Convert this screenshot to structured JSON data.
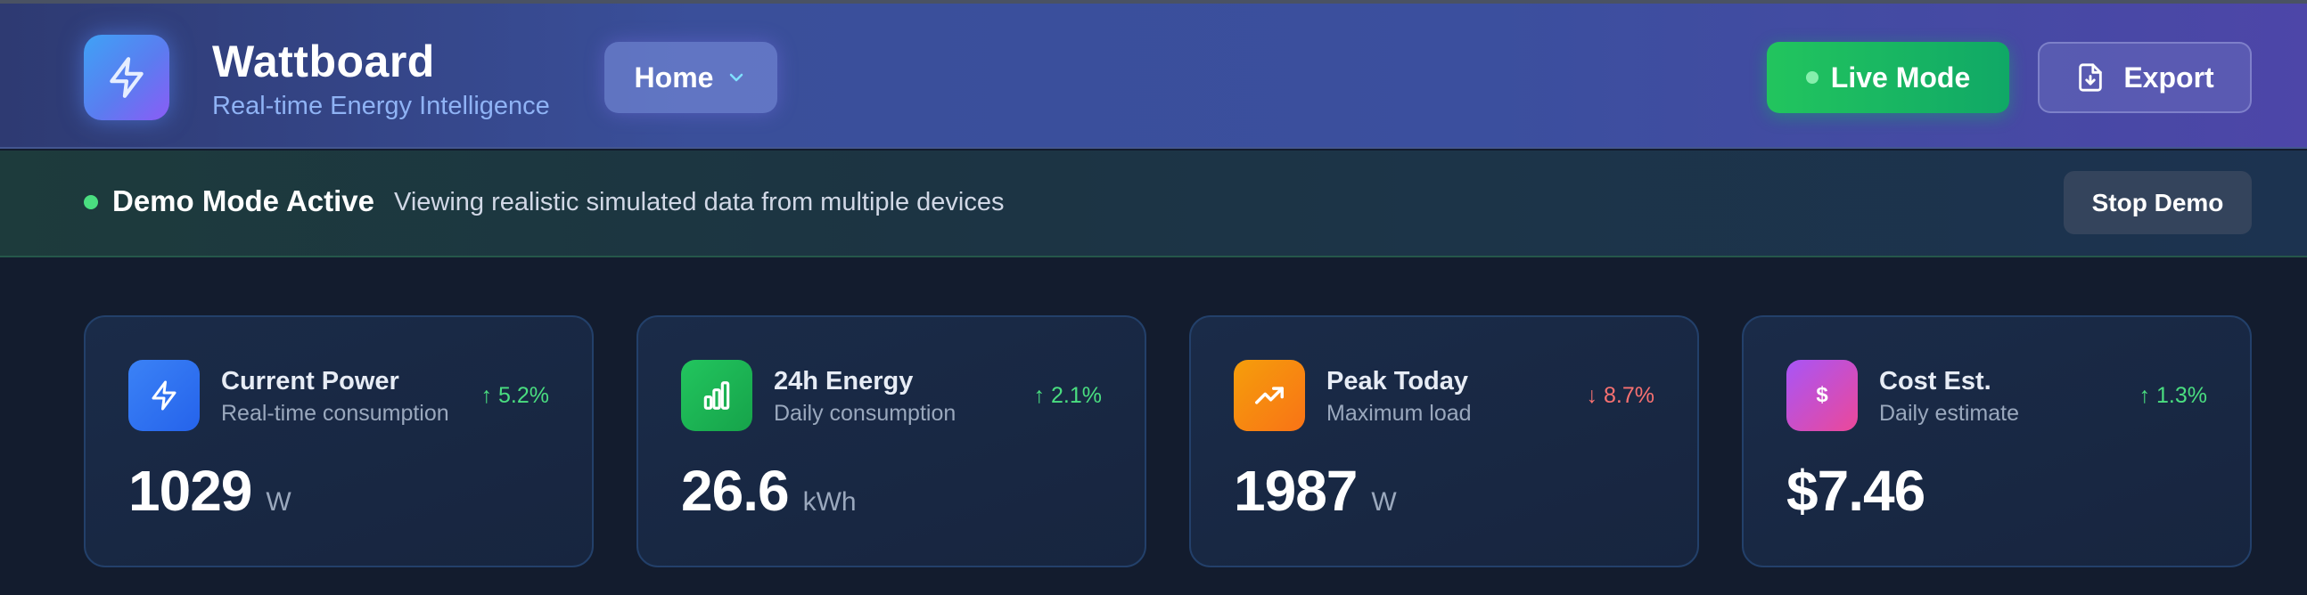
{
  "app": {
    "name": "Wattboard",
    "tagline": "Real-time Energy Intelligence",
    "logo_icon": "lightning-bolt-icon"
  },
  "header": {
    "nav_label": "Home",
    "live_button": "Live Mode",
    "export_button": "Export"
  },
  "banner": {
    "title": "Demo Mode Active",
    "message": "Viewing realistic simulated data from multiple devices",
    "stop_button": "Stop Demo"
  },
  "colors": {
    "accent_green": "#22c55e",
    "positive": "#4ade80",
    "negative": "#f87171"
  },
  "cards": [
    {
      "title": "Current Power",
      "subtitle": "Real-time consumption",
      "change": "↑ 5.2%",
      "trend": "up",
      "value": "1029",
      "unit": "W",
      "icon": "lightning-bolt-icon"
    },
    {
      "title": "24h Energy",
      "subtitle": "Daily consumption",
      "change": "↑ 2.1%",
      "trend": "up",
      "value": "26.6",
      "unit": "kWh",
      "icon": "bar-chart-icon"
    },
    {
      "title": "Peak Today",
      "subtitle": "Maximum load",
      "change": "↓ 8.7%",
      "trend": "down",
      "value": "1987",
      "unit": "W",
      "icon": "trending-up-icon"
    },
    {
      "title": "Cost Est.",
      "subtitle": "Daily estimate",
      "change": "↑ 1.3%",
      "trend": "up",
      "value": "$7.46",
      "unit": "",
      "icon": "dollar-icon",
      "icon_text": "$"
    }
  ]
}
